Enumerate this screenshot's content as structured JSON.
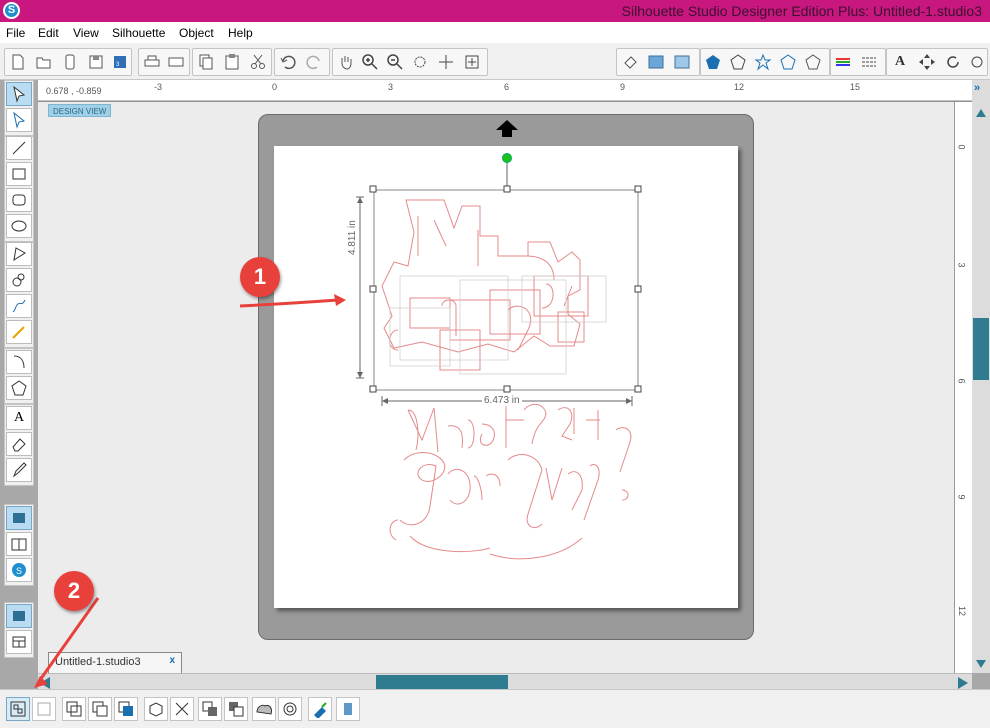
{
  "window": {
    "title": "Silhouette Studio Designer Edition Plus: Untitled-1.studio3",
    "logo": "S"
  },
  "menu": [
    "File",
    "Edit",
    "View",
    "Silhouette",
    "Object",
    "Help"
  ],
  "ruler": {
    "coords": "0.678 , -0.859",
    "h_ticks": [
      "-3",
      "0",
      "3",
      "6",
      "9",
      "12",
      "15"
    ],
    "v_ticks": [
      "0",
      "3",
      "6",
      "9",
      "12"
    ]
  },
  "design_view_label": "DESIGN VIEW",
  "selection": {
    "height_label": "4.811 in",
    "width_label": "6.473 in"
  },
  "document_tab": {
    "name": "Untitled-1.studio3",
    "close": "x"
  },
  "design_text": {
    "top": [
      "Made Just",
      "For You!"
    ],
    "bottom": [
      "Made Just",
      "For You!"
    ]
  },
  "annotations": [
    {
      "label": "1"
    },
    {
      "label": "2"
    }
  ],
  "colors": {
    "titlebar": "#c8177e",
    "accent": "#2f7c91",
    "annotation": "#e8413c",
    "cutline": "#e48a8a"
  },
  "icons": {
    "new": "new-page-icon",
    "open": "open-folder-icon",
    "save": "save-icon",
    "print": "print-icon",
    "cut": "scissors-icon",
    "undo": "undo-icon",
    "redo": "redo-icon",
    "pan": "hand-icon",
    "zoom_in": "zoom-in-icon",
    "zoom_out": "zoom-out-icon"
  }
}
